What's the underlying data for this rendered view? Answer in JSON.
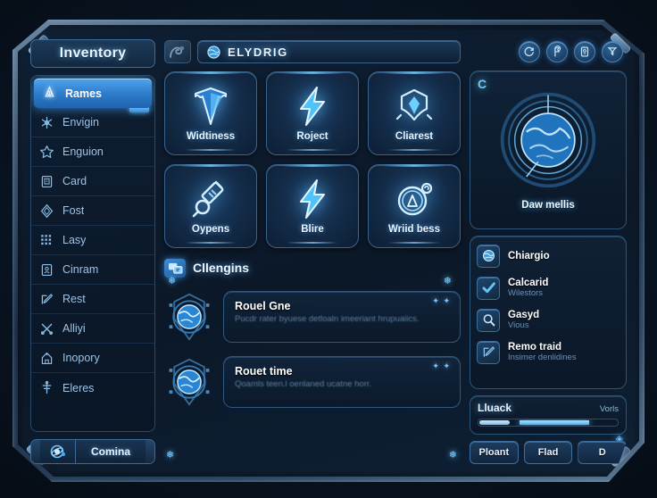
{
  "sidebar": {
    "title": "Inventory",
    "items": [
      {
        "label": "Rames",
        "icon": "diamond-crest-icon",
        "active": true
      },
      {
        "label": "Envigin",
        "icon": "snowflake-star-icon",
        "active": false
      },
      {
        "label": "Enguion",
        "icon": "star-badge-icon",
        "active": false
      },
      {
        "label": "Card",
        "icon": "card-icon",
        "active": false
      },
      {
        "label": "Fost",
        "icon": "gem-icon",
        "active": false
      },
      {
        "label": "Lasy",
        "icon": "dot-grid-icon",
        "active": false
      },
      {
        "label": "Cinram",
        "icon": "person-card-icon",
        "active": false
      },
      {
        "label": "Rest",
        "icon": "pen-edit-icon",
        "active": false
      },
      {
        "label": "Alliyi",
        "icon": "crossed-tools-icon",
        "active": false
      },
      {
        "label": "Inopory",
        "icon": "castle-icon",
        "active": false
      },
      {
        "label": "Eleres",
        "icon": "antenna-icon",
        "active": false
      }
    ],
    "footer": {
      "label": "Comina",
      "icon": "atom-orb-icon"
    }
  },
  "header": {
    "title": "ELYDRIG",
    "title_icon": "globe-icon",
    "ornament_icon": "ornament-icon",
    "tool_icons": [
      "refresh-cycle-icon",
      "flag-pin-icon",
      "document-icon",
      "filter-funnel-icon"
    ]
  },
  "cards": [
    {
      "label": "Widtiness",
      "icon": "shield-icon"
    },
    {
      "label": "Roject",
      "icon": "lightning-icon"
    },
    {
      "label": "Cliarest",
      "icon": "gem-crest-icon"
    },
    {
      "label": "Oypens",
      "icon": "syringe-magnifier-icon"
    },
    {
      "label": "Blire",
      "icon": "lightning-icon"
    },
    {
      "label": "Wriid bess",
      "icon": "compass-icon"
    }
  ],
  "section": {
    "title": "Cllengins",
    "icon": "quest-board-icon"
  },
  "quests": [
    {
      "title": "Rouel Gne",
      "subtitle": "Pucdr rater byuese detloaln imeeriant hrupuaiics.",
      "stars": "✦ ✦",
      "icon": "globe-orb-icon"
    },
    {
      "title": "Rouet time",
      "subtitle": "Qoamls teen.l oenlaned ucatne horr.",
      "stars": "✦ ✦",
      "icon": "globe-orb-icon"
    }
  ],
  "radar": {
    "badge": "C",
    "label": "Daw mellis",
    "icon": "globe-radar-icon"
  },
  "right_list": [
    {
      "name": "Chiargio",
      "sub": "",
      "icon": "planet-icon"
    },
    {
      "name": "Calcarid",
      "sub": "Wilestors",
      "icon": "checkmark-icon"
    },
    {
      "name": "Gasyd",
      "sub": "Vious",
      "icon": "search-icon"
    },
    {
      "name": "Remo traid",
      "sub": "Insimer denlidines",
      "icon": "pen-edit-icon"
    }
  ],
  "meter": {
    "name": "Lluack",
    "value": "Vorls",
    "segment_a_pct": 22,
    "segment_b_pct": 50,
    "icon": "gem-icon"
  },
  "actions": [
    {
      "label": "Ploant"
    },
    {
      "label": "Flad"
    },
    {
      "label": "D"
    }
  ],
  "colors": {
    "accent": "#4eb0ef",
    "accent_bright": "#7fd0ff",
    "panel": "#0f2133",
    "frame": "#3c5874",
    "text": "#e8f4ff",
    "text_muted": "#6d90b2"
  }
}
